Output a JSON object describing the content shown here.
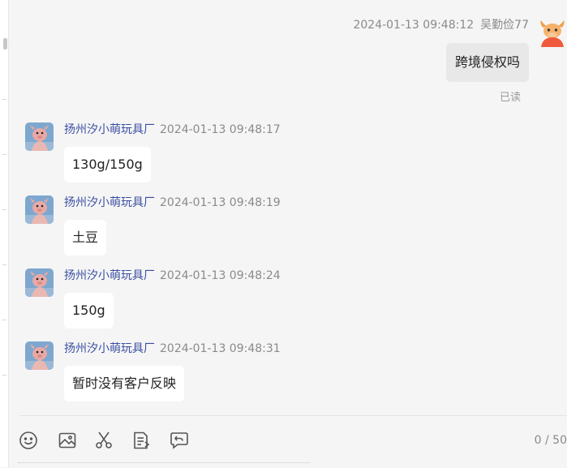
{
  "outgoing": {
    "timestamp": "2024-01-13 09:48:12",
    "sender": "吴勤俭77",
    "text": "跨境侵权吗",
    "status": "已读"
  },
  "incoming": [
    {
      "sender": "扬州汐小萌玩具厂",
      "timestamp": "2024-01-13 09:48:17",
      "text": "130g/150g"
    },
    {
      "sender": "扬州汐小萌玩具厂",
      "timestamp": "2024-01-13 09:48:19",
      "text": "土豆"
    },
    {
      "sender": "扬州汐小萌玩具厂",
      "timestamp": "2024-01-13 09:48:24",
      "text": "150g"
    },
    {
      "sender": "扬州汐小萌玩具厂",
      "timestamp": "2024-01-13 09:48:31",
      "text": "暂时没有客户反映"
    }
  ],
  "toolbar": {
    "icons": [
      "emoji-icon",
      "image-icon",
      "scissors-icon",
      "document-icon",
      "quick-reply-icon"
    ],
    "counter": "0 / 50"
  },
  "colors": {
    "background": "#f5f5f5",
    "sender_name": "#3b4fa3",
    "incoming_bubble": "#ffffff",
    "outgoing_bubble": "#e8e8e8",
    "meta_text": "#8a8a8a"
  }
}
